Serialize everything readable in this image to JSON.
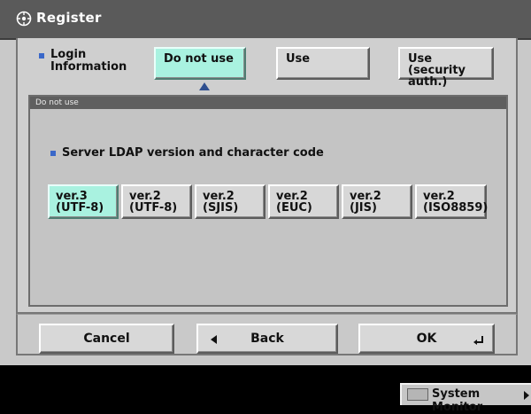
{
  "window": {
    "title": "Register",
    "title_icon": "ldap-register-icon"
  },
  "login": {
    "label_line1": "Login",
    "label_line2": "Information",
    "options": [
      {
        "line1": "Do not use",
        "line2": "",
        "selected": true
      },
      {
        "line1": "Use",
        "line2": "",
        "selected": false
      },
      {
        "line1": "Use (security",
        "line2": "auth.)",
        "selected": false
      }
    ]
  },
  "panel": {
    "header": "Do not use",
    "section_label": "Server LDAP version and character code",
    "versions": [
      {
        "line1": "ver.3",
        "line2": "(UTF-8)",
        "selected": true
      },
      {
        "line1": "ver.2",
        "line2": "(UTF-8)",
        "selected": false
      },
      {
        "line1": "ver.2",
        "line2": "(SJIS)",
        "selected": false
      },
      {
        "line1": "ver.2",
        "line2": "(EUC)",
        "selected": false
      },
      {
        "line1": "ver.2",
        "line2": "(JIS)",
        "selected": false
      },
      {
        "line1": "ver.2",
        "line2": "(ISO8859)",
        "selected": false
      }
    ]
  },
  "actions": {
    "cancel": "Cancel",
    "back": "Back",
    "ok": "OK"
  },
  "taskbar": {
    "system_monitor": "System Monitor"
  },
  "colors": {
    "selected": "#a9f2e0",
    "accent_bullet": "#3a68c9",
    "titlebar": "#5a5a5a"
  }
}
